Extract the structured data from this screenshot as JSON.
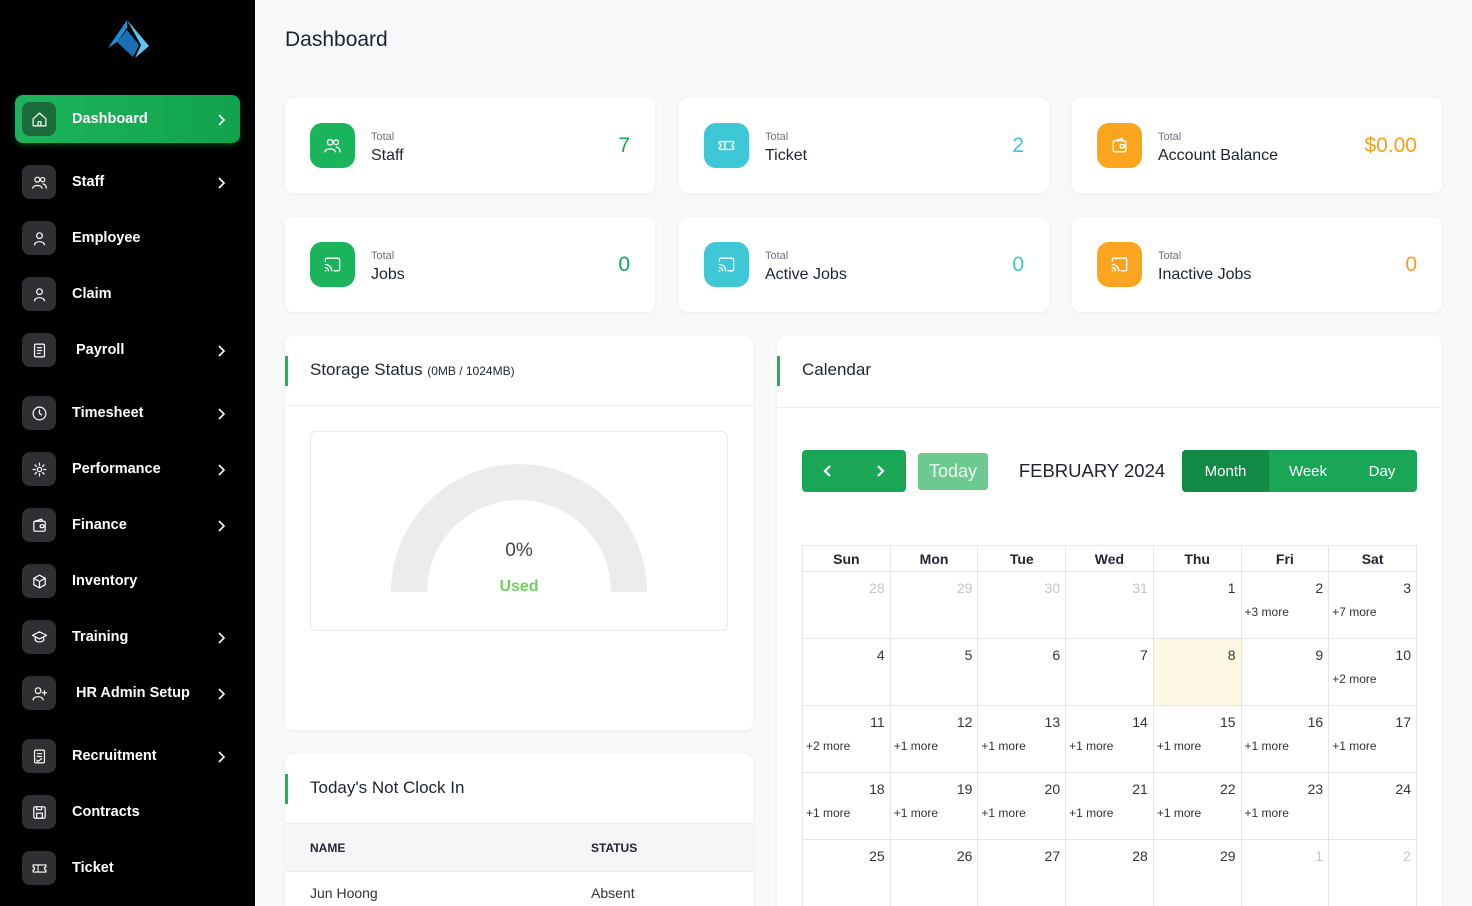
{
  "sidebar": {
    "items": [
      {
        "label": "Dashboard",
        "icon": "home-icon",
        "chevron": true,
        "active": true
      },
      {
        "label": "Staff",
        "icon": "users-icon",
        "chevron": true
      },
      {
        "label": "Employee",
        "icon": "user-icon",
        "chevron": false
      },
      {
        "label": "Claim",
        "icon": "user-icon",
        "chevron": false
      },
      {
        "label": "Payroll",
        "icon": "receipt-icon",
        "chevron": true
      },
      {
        "label": "Timesheet",
        "icon": "clock-icon",
        "chevron": true
      },
      {
        "label": "Performance",
        "icon": "performance-icon",
        "chevron": true
      },
      {
        "label": "Finance",
        "icon": "wallet-icon",
        "chevron": true
      },
      {
        "label": "Inventory",
        "icon": "box-icon",
        "chevron": false
      },
      {
        "label": "Training",
        "icon": "graduation-cap-icon",
        "chevron": true
      },
      {
        "label": "HR Admin Setup",
        "icon": "user-plus-icon",
        "chevron": true
      },
      {
        "label": "Recruitment",
        "icon": "document-icon",
        "chevron": true
      },
      {
        "label": "Contracts",
        "icon": "floppy-icon",
        "chevron": false
      },
      {
        "label": "Ticket",
        "icon": "ticket-icon",
        "chevron": false
      }
    ]
  },
  "page": {
    "title": "Dashboard"
  },
  "stats": [
    {
      "small": "Total",
      "label": "Staff",
      "value": "7",
      "color": "#19b45c",
      "icon": "users-icon"
    },
    {
      "small": "Total",
      "label": "Ticket",
      "value": "2",
      "color": "#3ec7d4",
      "icon": "ticket-icon"
    },
    {
      "small": "Total",
      "label": "Account Balance",
      "value": "$0.00",
      "color": "#fba51e",
      "icon": "wallet-icon"
    },
    {
      "small": "Total",
      "label": "Jobs",
      "value": "0",
      "color": "#19b45c",
      "icon": "cast-icon"
    },
    {
      "small": "Total",
      "label": "Active Jobs",
      "value": "0",
      "color": "#3ec7d4",
      "icon": "cast-icon"
    },
    {
      "small": "Total",
      "label": "Inactive Jobs",
      "value": "0",
      "color": "#fba51e",
      "icon": "cast-icon"
    }
  ],
  "storage": {
    "title": "Storage Status",
    "sub": "(0MB / 1024MB)",
    "percent_label": "0%",
    "used_label": "Used",
    "used_fraction": 0
  },
  "not_clock_in": {
    "title": "Today's Not Clock In",
    "col_name": "NAME",
    "col_status": "STATUS",
    "rows": [
      {
        "name": "Jun Hoong",
        "status": "Absent"
      }
    ]
  },
  "calendar": {
    "title": "Calendar",
    "today_label": "Today",
    "month_title": "FEBRUARY 2024",
    "views": [
      "Month",
      "Week",
      "Day"
    ],
    "active_view": "Month",
    "weekdays": [
      "Sun",
      "Mon",
      "Tue",
      "Wed",
      "Thu",
      "Fri",
      "Sat"
    ],
    "weeks": [
      [
        {
          "d": "28",
          "o": true
        },
        {
          "d": "29",
          "o": true
        },
        {
          "d": "30",
          "o": true
        },
        {
          "d": "31",
          "o": true
        },
        {
          "d": "1"
        },
        {
          "d": "2",
          "m": "+3 more"
        },
        {
          "d": "3",
          "m": "+7 more"
        }
      ],
      [
        {
          "d": "4"
        },
        {
          "d": "5"
        },
        {
          "d": "6"
        },
        {
          "d": "7"
        },
        {
          "d": "8",
          "t": true
        },
        {
          "d": "9"
        },
        {
          "d": "10",
          "m": "+2 more"
        }
      ],
      [
        {
          "d": "11",
          "m": "+2 more"
        },
        {
          "d": "12",
          "m": "+1 more"
        },
        {
          "d": "13",
          "m": "+1 more"
        },
        {
          "d": "14",
          "m": "+1 more"
        },
        {
          "d": "15",
          "m": "+1 more"
        },
        {
          "d": "16",
          "m": "+1 more"
        },
        {
          "d": "17",
          "m": "+1 more"
        }
      ],
      [
        {
          "d": "18",
          "m": "+1 more"
        },
        {
          "d": "19",
          "m": "+1 more"
        },
        {
          "d": "20",
          "m": "+1 more"
        },
        {
          "d": "21",
          "m": "+1 more"
        },
        {
          "d": "22",
          "m": "+1 more"
        },
        {
          "d": "23",
          "m": "+1 more"
        },
        {
          "d": "24"
        }
      ],
      [
        {
          "d": "25"
        },
        {
          "d": "26"
        },
        {
          "d": "27"
        },
        {
          "d": "28"
        },
        {
          "d": "29"
        },
        {
          "d": "1",
          "o": true
        },
        {
          "d": "2",
          "o": true
        }
      ]
    ]
  }
}
